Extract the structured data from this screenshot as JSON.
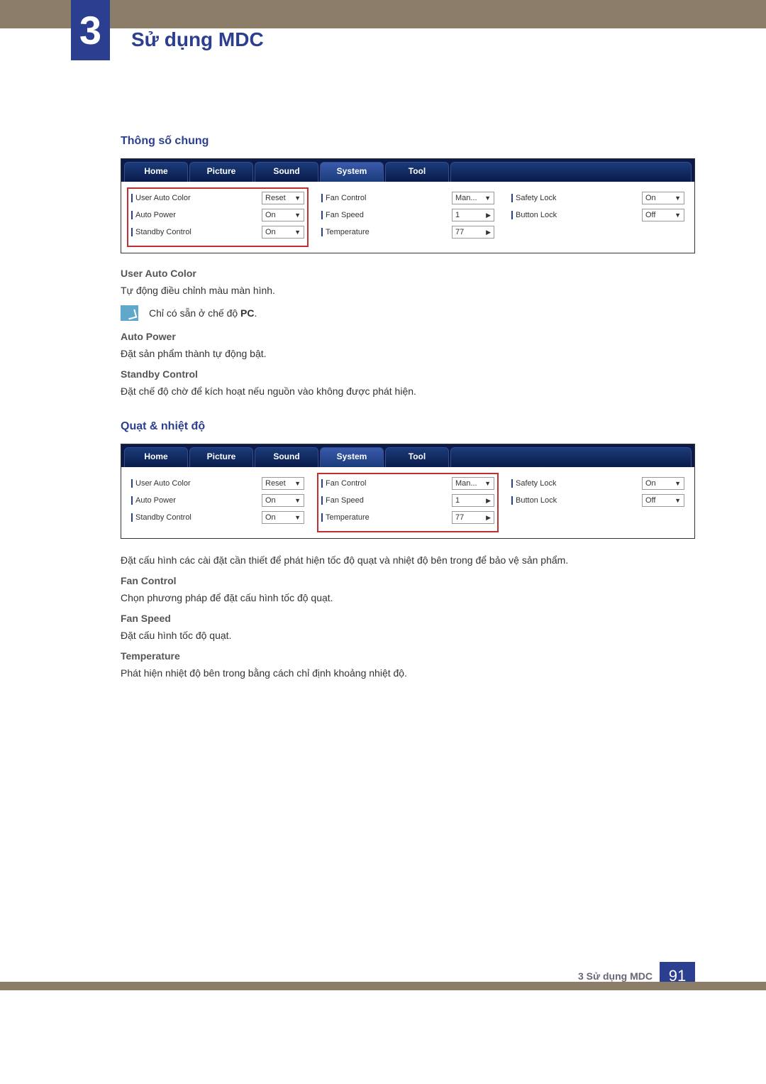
{
  "header": {
    "chapter_number": "3",
    "chapter_title": "Sử dụng MDC"
  },
  "section1": {
    "title": "Thông số chung"
  },
  "panel": {
    "tabs": [
      "Home",
      "Picture",
      "Sound",
      "System",
      "Tool"
    ],
    "active_tab": "System",
    "col1": [
      {
        "label": "User Auto Color",
        "value": "Reset",
        "control": "dropdown"
      },
      {
        "label": "Auto Power",
        "value": "On",
        "control": "dropdown"
      },
      {
        "label": "Standby Control",
        "value": "On",
        "control": "dropdown"
      }
    ],
    "col2": [
      {
        "label": "Fan Control",
        "value": "Man...",
        "control": "dropdown"
      },
      {
        "label": "Fan Speed",
        "value": "1",
        "control": "spinner"
      },
      {
        "label": "Temperature",
        "value": "77",
        "control": "spinner"
      }
    ],
    "col3": [
      {
        "label": "Safety Lock",
        "value": "On",
        "control": "dropdown"
      },
      {
        "label": "Button Lock",
        "value": "Off",
        "control": "dropdown"
      }
    ]
  },
  "desc1": {
    "h_user_auto_color": "User Auto Color",
    "t_user_auto_color": "Tự động điều chỉnh màu màn hình.",
    "note_prefix": "Chỉ có sẵn ở chế độ ",
    "note_bold": "PC",
    "note_suffix": ".",
    "h_auto_power": "Auto Power",
    "t_auto_power": "Đặt sản phẩm thành tự động bật.",
    "h_standby": "Standby Control",
    "t_standby": "Đặt chế độ chờ để kích hoạt nếu nguồn vào không được phát hiện."
  },
  "section2": {
    "title": "Quạt & nhiệt độ",
    "intro": "Đặt cấu hình các cài đặt cần thiết để phát hiện tốc độ quạt và nhiệt độ bên trong để bảo vệ sản phẩm.",
    "h_fan_control": "Fan Control",
    "t_fan_control": "Chọn phương pháp để đặt cấu hình tốc độ quạt.",
    "h_fan_speed": "Fan Speed",
    "t_fan_speed": "Đặt cấu hình tốc độ quạt.",
    "h_temperature": "Temperature",
    "t_temperature": "Phát hiện nhiệt độ bên trong bằng cách chỉ định khoảng nhiệt độ."
  },
  "footer": {
    "text": "3 Sử dụng MDC",
    "page": "91"
  }
}
